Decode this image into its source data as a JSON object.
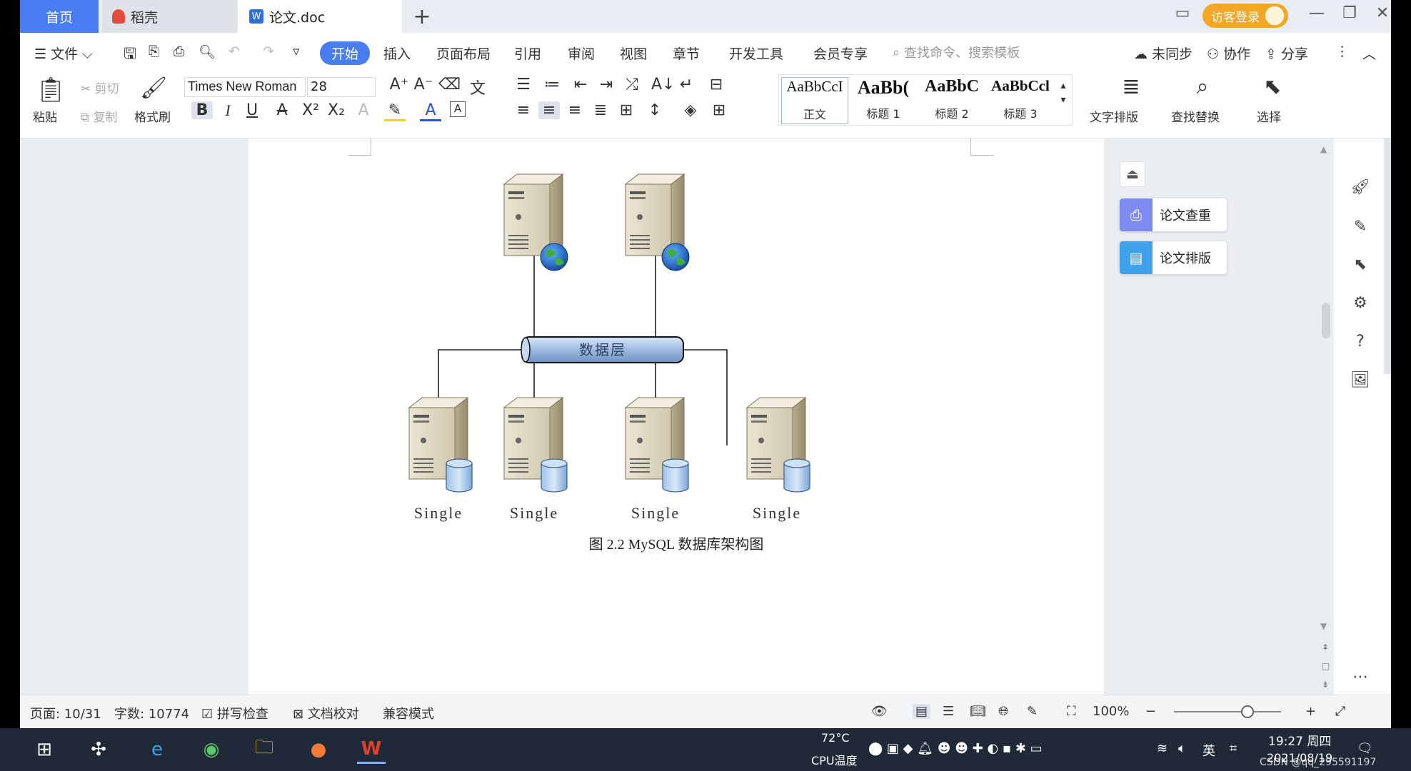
{
  "tabs": {
    "home": "首页",
    "daoke": "稻壳",
    "doc": "论文.doc",
    "add": "+"
  },
  "titlebar": {
    "login": "访客登录"
  },
  "menu": {
    "file": "文件",
    "items": [
      "开始",
      "插入",
      "页面布局",
      "引用",
      "审阅",
      "视图",
      "章节",
      "开发工具",
      "会员专享"
    ],
    "search_placeholder": "查找命令、搜索模板",
    "sync": "未同步",
    "collab": "协作",
    "share": "分享"
  },
  "ribbon": {
    "paste": "粘贴",
    "cut": "剪切",
    "copy": "复制",
    "format_painter": "格式刷",
    "font_name": "Times New Roman",
    "font_size": "28",
    "styles": [
      {
        "sample": "AaBbCcI",
        "name": "正文"
      },
      {
        "sample": "AaBb(",
        "name": "标题 1"
      },
      {
        "sample": "AaBbC",
        "name": "标题 2"
      },
      {
        "sample": "AaBbCcl",
        "name": "标题 3"
      }
    ],
    "text_layout": "文字排版",
    "find_replace": "查找替换",
    "select": "选择"
  },
  "figure": {
    "bus_label": "数据层",
    "nodes": [
      "Single",
      "Single",
      "Single",
      "Single"
    ],
    "caption": "图 2.2 MySQL 数据库架构图"
  },
  "side_panel": {
    "check": "论文查重",
    "layout": "论文排版"
  },
  "status": {
    "page": "页面: 10/31",
    "words": "字数: 10774",
    "spell": "拼写检查",
    "proof": "文档校对",
    "compat": "兼容模式",
    "zoom": "100%"
  },
  "taskbar": {
    "temp": "72°C",
    "cpu": "CPU温度",
    "lang": "英",
    "time": "19:27 周四",
    "date": "2021/08/19",
    "watermark": "CSDN @qq_295591197"
  },
  "colors": {
    "accent": "#4a7cf2",
    "login": "#f5a623",
    "bus": "#9dbbe0"
  }
}
